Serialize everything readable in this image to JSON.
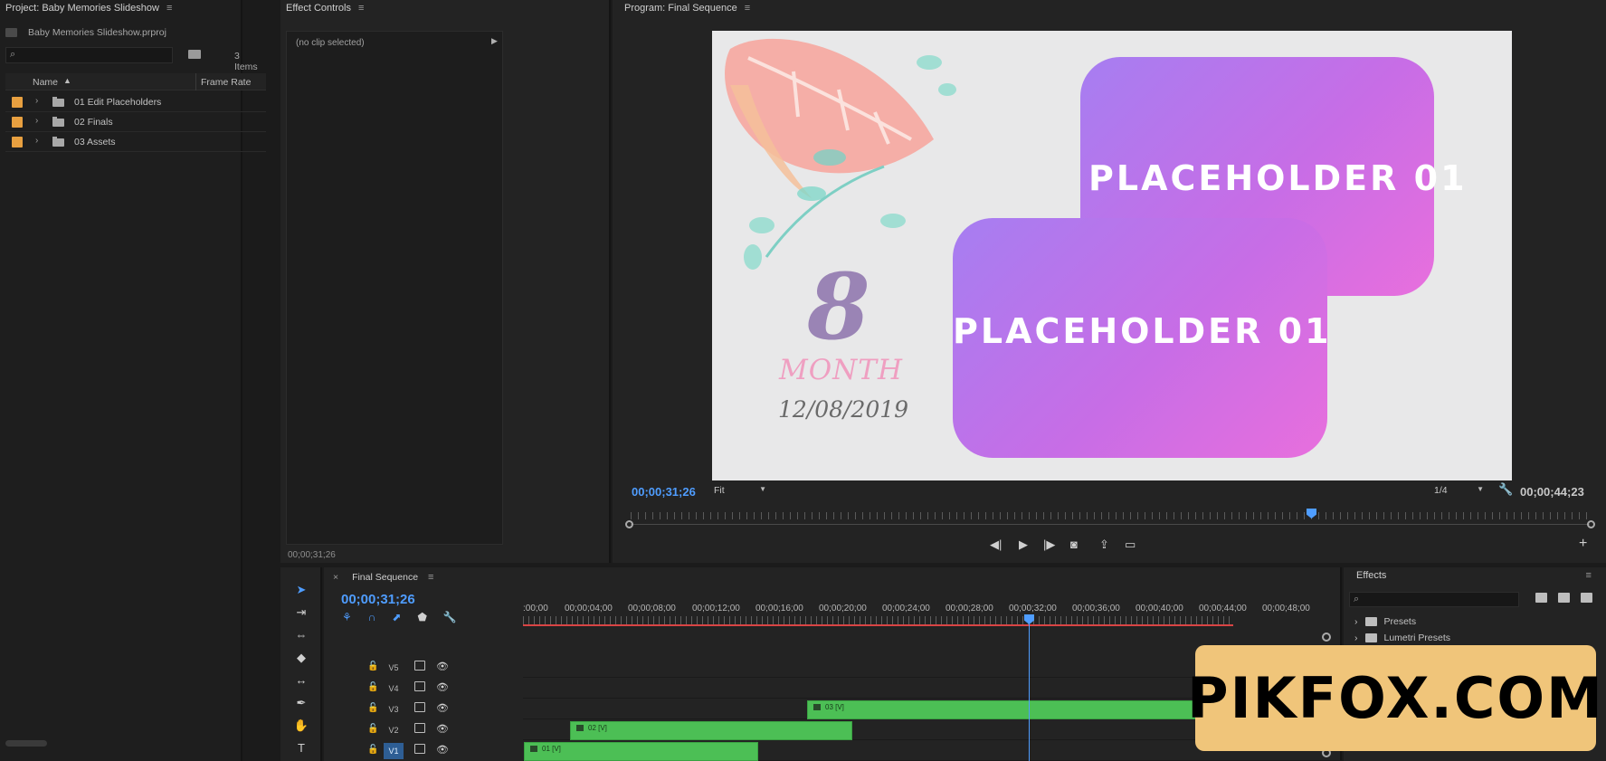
{
  "project": {
    "title": "Project: Baby Memories Slideshow",
    "file_name": "Baby Memories Slideshow.prproj",
    "items_count": "3 Items",
    "col_name": "Name",
    "col_rate": "Frame Rate",
    "bins": [
      {
        "name": "01 Edit Placeholders"
      },
      {
        "name": "02 Finals"
      },
      {
        "name": "03 Assets"
      }
    ]
  },
  "effect_controls": {
    "title": "Effect Controls",
    "no_clip": "(no clip selected)",
    "timecode": "00;00;31;26"
  },
  "program": {
    "title": "Program: Final Sequence",
    "frame": {
      "placeholder_top": "PLACEHOLDER 01",
      "placeholder_bottom": "PLACEHOLDER 01",
      "number": "8",
      "month": "MONTH",
      "date": "12/08/2019"
    },
    "timecode_current": "00;00;31;26",
    "fit": "Fit",
    "resolution": "1/4",
    "timecode_duration": "00;00;44;23"
  },
  "timeline": {
    "tab": "Final Sequence",
    "timecode": "00;00;31;26",
    "ticks": [
      ":00;00",
      "00;00;04;00",
      "00;00;08;00",
      "00;00;12;00",
      "00;00;16;00",
      "00;00;20;00",
      "00;00;24;00",
      "00;00;28;00",
      "00;00;32;00",
      "00;00;36;00",
      "00;00;40;00",
      "00;00;44;00",
      "00;00;48;00"
    ],
    "tracks": [
      {
        "name": "V5",
        "target": false
      },
      {
        "name": "V4",
        "target": false
      },
      {
        "name": "V3",
        "target": false
      },
      {
        "name": "V2",
        "target": false
      },
      {
        "name": "V1",
        "target": true
      }
    ],
    "clips": [
      {
        "label": "03 [V]",
        "track": "V3"
      },
      {
        "label": "02 [V]",
        "track": "V2"
      },
      {
        "label": "01 [V]",
        "track": "V1"
      }
    ]
  },
  "effects": {
    "title": "Effects",
    "items": [
      {
        "name": "Presets"
      },
      {
        "name": "Lumetri Presets"
      }
    ]
  },
  "watermark": {
    "text": "PIKFOX.COM"
  },
  "colors": {
    "accent_blue": "#4f9dff",
    "clip_green": "#4cbf55",
    "label_orange": "#e8a040",
    "watermark_bg": "#f0c57a"
  }
}
